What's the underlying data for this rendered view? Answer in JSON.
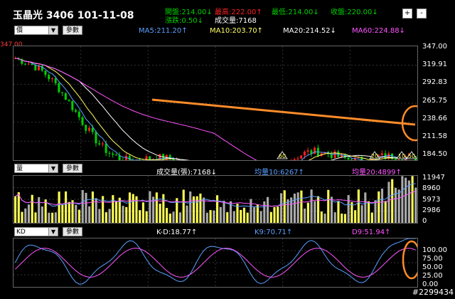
{
  "header": {
    "title": "玉晶光 3406 101-11-08",
    "open": "開盤:214.00↓",
    "change": "漲跌:0.50↓",
    "high": "最高:222.00↑",
    "volume": "成交量:7168",
    "low": "最低:214.00↓",
    "close": "收盤:220.00↓",
    "plus": "+",
    "minus": "-"
  },
  "price_panel": {
    "select": "價",
    "param_btn": "參數",
    "ma5": "MA5:211.20↑",
    "ma10": "MA10:203.70↑",
    "ma20": "MA20:214.52↓",
    "ma60": "MA60:224.88↓",
    "top_value": "347.00",
    "axis": [
      "347.00",
      "319.91",
      "292.83",
      "265.75",
      "238.66",
      "211.58",
      "184.50"
    ],
    "markers": [
      "60",
      "20",
      "10",
      "50"
    ]
  },
  "volume_panel": {
    "select": "量",
    "param_btn": "參數",
    "vol": "成交量(張):7168↓",
    "avg10": "均量10:6267↑",
    "avg20": "均量20:4899↑",
    "axis": [
      "11947",
      "8960",
      "5973",
      "2986",
      "0"
    ]
  },
  "kd_panel": {
    "select": "KD",
    "param_btn": "參數",
    "kd": "K-D:18.77↑",
    "k": "K9:70.71↑",
    "d": "D9:51.94↑",
    "axis": [
      "100.00",
      "75.00",
      "50.00",
      "25.00",
      "0.00"
    ]
  },
  "watermark": "#2299434",
  "colors": {
    "up": "#ff2020",
    "down": "#00d000",
    "ma5": "#5aa0ff",
    "ma10": "#ffff66",
    "ma20": "#ffffff",
    "ma60": "#ff55ff",
    "annotation": "#ff8c2a"
  }
}
